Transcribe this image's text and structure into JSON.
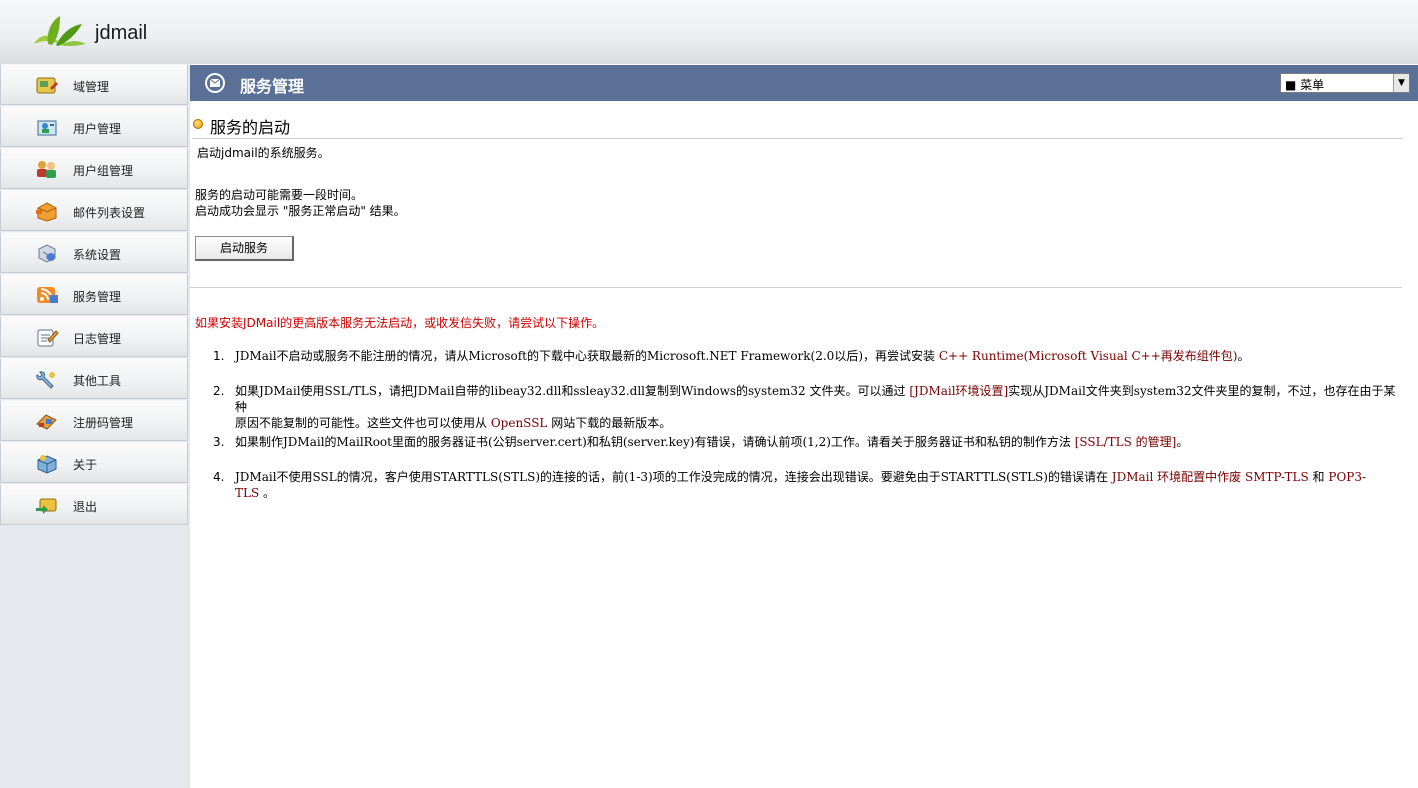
{
  "app": {
    "brand": "jdmail"
  },
  "sidebar": {
    "items": [
      {
        "label": "域管理",
        "icon": "domain-icon"
      },
      {
        "label": "用户管理",
        "icon": "user-icon"
      },
      {
        "label": "用户组管理",
        "icon": "user-group-icon"
      },
      {
        "label": "邮件列表设置",
        "icon": "mail-list-icon"
      },
      {
        "label": "系统设置",
        "icon": "system-settings-icon"
      },
      {
        "label": "服务管理",
        "icon": "service-icon"
      },
      {
        "label": "日志管理",
        "icon": "log-icon"
      },
      {
        "label": "其他工具",
        "icon": "tools-icon"
      },
      {
        "label": "注册码管理",
        "icon": "license-icon"
      },
      {
        "label": "关于",
        "icon": "about-icon"
      },
      {
        "label": "退出",
        "icon": "logout-icon"
      }
    ]
  },
  "header": {
    "title": "服务管理",
    "menu_label": "■ 菜单"
  },
  "content": {
    "section_title": "服务的启动",
    "intro": "启动jdmail的系统服务。",
    "note1": "服务的启动可能需要一段时间。",
    "note2": "启动成功会显示 \"服务正常启动\" 结果。",
    "start_button": "启动服务",
    "warning": "如果安装JDMail的更高版本服务无法启动，或收发信失败，请尝试以下操作。",
    "steps": [
      {
        "num": "1.",
        "text_a": "JDMail不启动或服务不能注册的情况，请从Microsoft的下载中心获取最新的Microsoft.NET Framework(2.0以后)，再尝试安装 ",
        "link": "C++ Runtime(Microsoft Visual C++再发布组件包)",
        "text_b": "。"
      },
      {
        "num": "2.",
        "text_a": "如果JDMail使用SSL/TLS，请把JDMail自带的libeay32.dll和ssleay32.dll复制到Windows的system32 文件夹。可以通过 ",
        "link": "[JDMail环境设置]",
        "text_b": "实现从JDMail文件夹到system32文件夹里的复制，不过，也存在由于某种",
        "text_c": "原因不能复制的可能性。这些文件也可以使用从 ",
        "link2": "OpenSSL",
        "text_d": " 网站下载的最新版本。"
      },
      {
        "num": "3.",
        "text_a": "如果制作JDMail的MailRoot里面的服务器证书(公钥server.cert)和私钥(server.key)有错误，请确认前项(1,2)工作。请看关于服务器证书和私钥的制作方法 ",
        "link": "[SSL/TLS 的管理]",
        "text_b": "。"
      },
      {
        "num": "4.",
        "text_a": "JDMail不使用SSL的情况，客户使用STARTTLS(STLS)的连接的话，前(1-3)项的工作没完成的情况，连接会出现错误。要避免由于STARTTLS(STLS)的错误请在 ",
        "link": "JDMail 环境配置中作废",
        "text_b": " ",
        "link2": "SMTP-TLS",
        "text_c": " 和 ",
        "link3": "POP3-",
        "text_d": "TLS",
        "text_e": " 。"
      }
    ]
  },
  "colors": {
    "header_bg": "#5a7096",
    "warning": "#cc0000",
    "link": "#7a0000",
    "sidebar_bg": "#e5e9ee"
  }
}
